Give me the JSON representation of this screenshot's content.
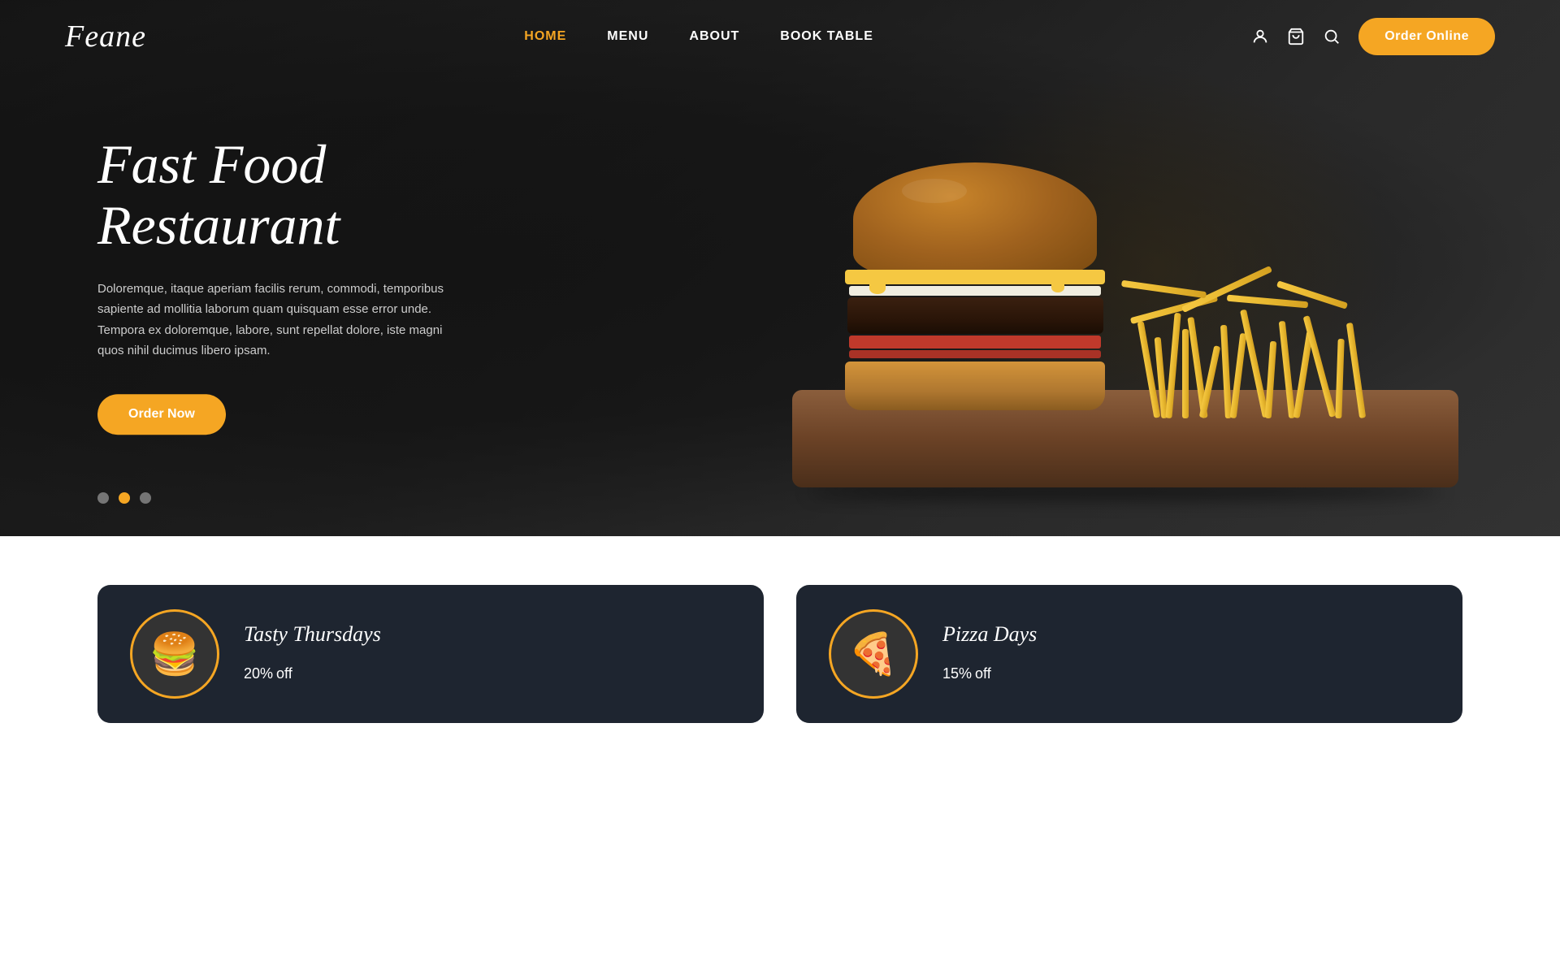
{
  "site": {
    "logo": "Feane",
    "accent_color": "#f5a623",
    "dark_bg": "#1a1a1a"
  },
  "header": {
    "nav": [
      {
        "id": "home",
        "label": "HOME",
        "active": true
      },
      {
        "id": "menu",
        "label": "MENU",
        "active": false
      },
      {
        "id": "about",
        "label": "ABOUT",
        "active": false
      },
      {
        "id": "book-table",
        "label": "BOOK TABLE",
        "active": false
      }
    ],
    "order_online_label": "Order Online"
  },
  "hero": {
    "title": "Fast Food Restaurant",
    "description": "Doloremque, itaque aperiam facilis rerum, commodi, temporibus sapiente ad mollitia laborum quam quisquam esse error unde. Tempora ex doloremque, labore, sunt repellat dolore, iste magni quos nihil ducimus libero ipsam.",
    "cta_label": "Order Now",
    "carousel": {
      "dots": [
        {
          "id": 1,
          "active": false
        },
        {
          "id": 2,
          "active": true
        },
        {
          "id": 3,
          "active": false
        }
      ]
    }
  },
  "promo": {
    "cards": [
      {
        "id": "tasty-thursdays",
        "title": "Tasty Thursdays",
        "discount": "20%",
        "suffix": "off",
        "icon": "🍔"
      },
      {
        "id": "pizza-days",
        "title": "Pizza Days",
        "discount": "15%",
        "suffix": "off",
        "icon": "🍕"
      }
    ]
  },
  "icons": {
    "user": "user-icon",
    "cart": "cart-icon",
    "search": "search-icon"
  }
}
